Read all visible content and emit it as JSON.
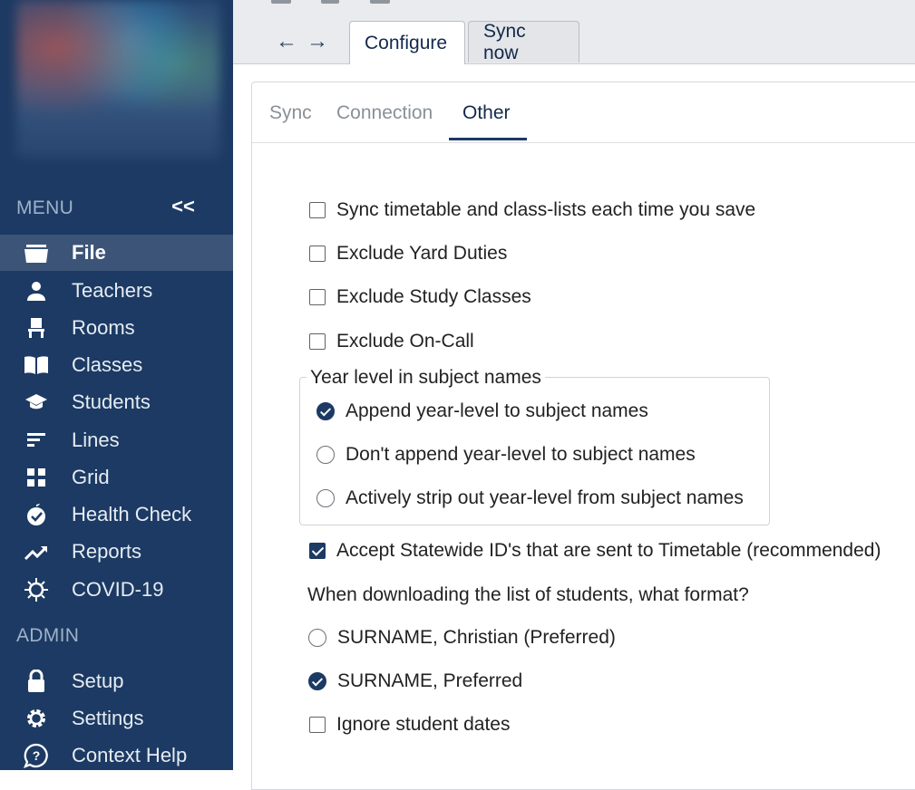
{
  "sidebar": {
    "menu_title": "MENU",
    "collapse_label": "<<",
    "admin_title": "ADMIN",
    "items": [
      {
        "label": "File",
        "icon": "folder-icon",
        "active": true
      },
      {
        "label": "Teachers",
        "icon": "person-icon"
      },
      {
        "label": "Rooms",
        "icon": "chair-icon"
      },
      {
        "label": "Classes",
        "icon": "book-icon"
      },
      {
        "label": "Students",
        "icon": "graduation-cap-icon"
      },
      {
        "label": "Lines",
        "icon": "lines-icon"
      },
      {
        "label": "Grid",
        "icon": "grid-icon"
      },
      {
        "label": "Health Check",
        "icon": "apple-check-icon"
      },
      {
        "label": "Reports",
        "icon": "trending-up-icon"
      },
      {
        "label": "COVID-19",
        "icon": "virus-icon"
      }
    ],
    "admin_items": [
      {
        "label": "Setup",
        "icon": "lock-icon"
      },
      {
        "label": "Settings",
        "icon": "gear-icon"
      },
      {
        "label": "Context Help",
        "icon": "help-bubble-icon"
      }
    ]
  },
  "topbar": {
    "back_label": "←",
    "forward_label": "→",
    "tabs": [
      {
        "label": "Configure",
        "active": true
      },
      {
        "label": "Sync now"
      }
    ]
  },
  "subtabs": [
    {
      "label": "Sync"
    },
    {
      "label": "Connection"
    },
    {
      "label": "Other",
      "active": true
    }
  ],
  "options": {
    "sync_each_save": {
      "label": "Sync timetable and class-lists each time you save",
      "checked": false
    },
    "exclude_yard": {
      "label": "Exclude Yard Duties",
      "checked": false
    },
    "exclude_study": {
      "label": "Exclude Study Classes",
      "checked": false
    },
    "exclude_oncall": {
      "label": "Exclude On-Call",
      "checked": false
    },
    "year_level_legend": "Year level in subject names",
    "year_level": [
      {
        "label": "Append year-level to subject names",
        "checked": true
      },
      {
        "label": "Don't append year-level to subject names",
        "checked": false
      },
      {
        "label": "Actively strip out year-level from subject names",
        "checked": false
      }
    ],
    "accept_statewide": {
      "label": "Accept Statewide ID's that are sent to Timetable (recommended)",
      "checked": true
    },
    "format_question": "When downloading the list of students, what format?",
    "formats": [
      {
        "label": "SURNAME, Christian (Preferred)",
        "checked": false
      },
      {
        "label": "SURNAME, Preferred",
        "checked": true
      }
    ],
    "ignore_dates": {
      "label": "Ignore student dates",
      "checked": false
    }
  },
  "colors": {
    "sidebar": "#1c3a63",
    "active_item": "#3c5478",
    "accent": "#1c3a63"
  }
}
